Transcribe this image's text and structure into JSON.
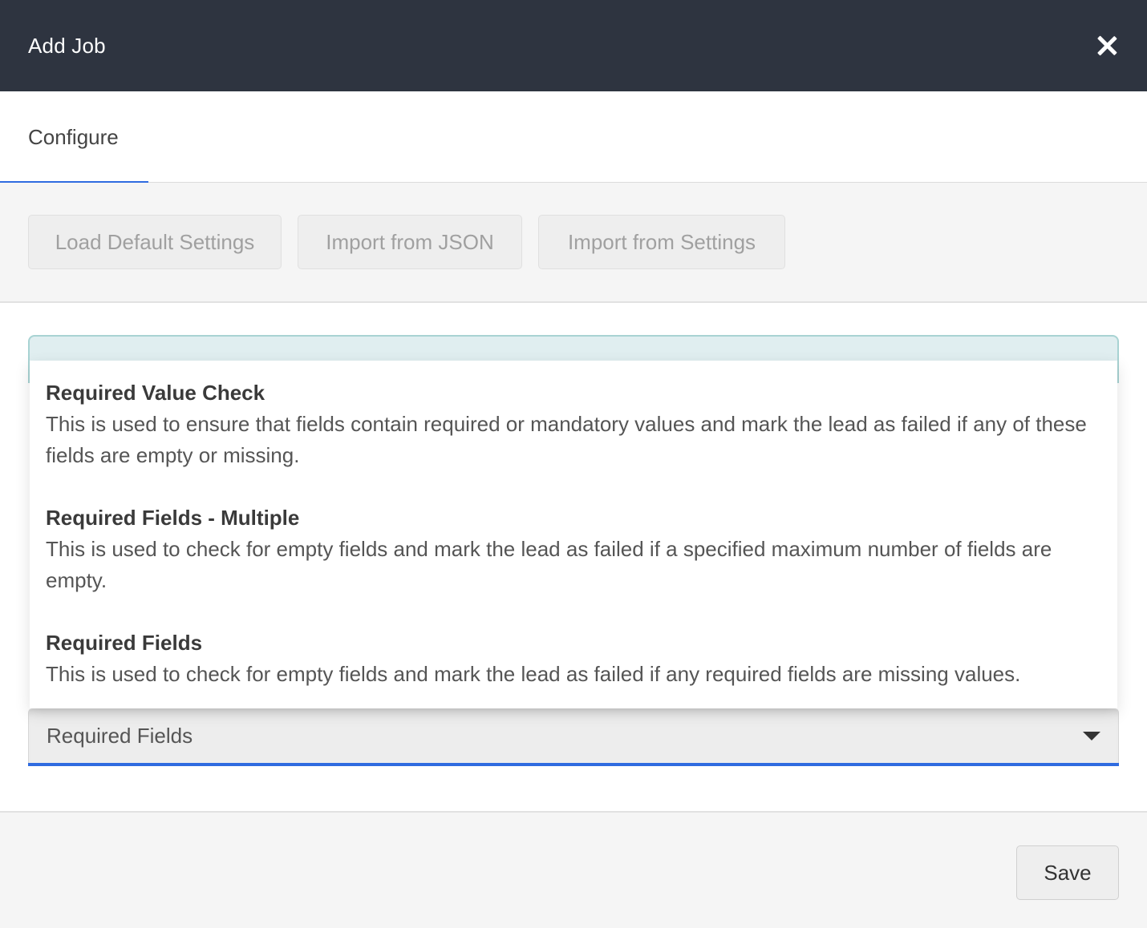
{
  "header": {
    "title": "Add Job",
    "close_icon": "close-icon"
  },
  "tabs": [
    {
      "label": "Configure",
      "active": true
    }
  ],
  "toolbar": {
    "load_default_label": "Load Default Settings",
    "import_json_label": "Import from JSON",
    "import_settings_label": "Import from Settings"
  },
  "dropdown": {
    "options": [
      {
        "title": "Required Value Check",
        "description": "This is used to ensure that fields contain required or mandatory values and mark the lead as failed if any of these fields are empty or missing."
      },
      {
        "title": "Required Fields - Multiple",
        "description": "This is used to check for empty fields and mark the lead as failed if a specified maximum number of fields are empty."
      },
      {
        "title": "Required Fields",
        "description": "This is used to check for empty fields and mark the lead as failed if any required fields are missing values."
      }
    ],
    "selected_value": "Required Fields"
  },
  "footer": {
    "save_label": "Save"
  },
  "colors": {
    "header_bg": "#2e3440",
    "accent": "#2f6be0",
    "info_bg": "#e0eef0",
    "info_border": "#a8d3d3"
  }
}
